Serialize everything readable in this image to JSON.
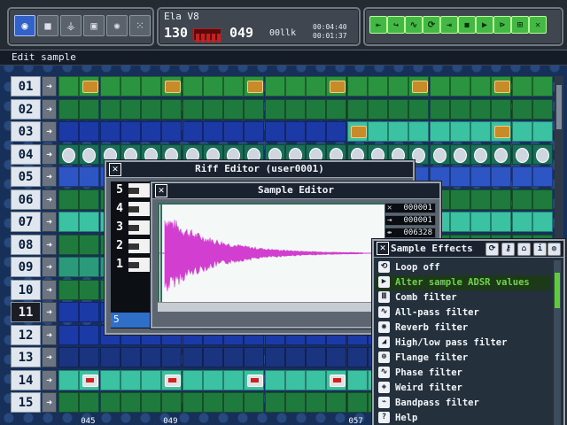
{
  "toolbar": {
    "tool_icons": [
      "mode-icon",
      "pattern-icon",
      "plug-icon",
      "save-icon",
      "spiral-icon",
      "grid-icon"
    ]
  },
  "song": {
    "name": "Ela V8",
    "bpm": "130",
    "position": "049",
    "pattern_label": "00llk",
    "time_current": "00:04:40",
    "time_total": "00:01:37"
  },
  "transport": {
    "buttons": [
      "rewind",
      "prev",
      "loop",
      "loop-alt",
      "forward",
      "record",
      "play",
      "cue",
      "next",
      "stop",
      "wave"
    ]
  },
  "edit_label": "Edit sample",
  "tracks": [
    "01",
    "02",
    "03",
    "04",
    "05",
    "06",
    "07",
    "08",
    "09",
    "10",
    "11",
    "12",
    "13",
    "14",
    "15"
  ],
  "column_numbers": [
    "045",
    "049",
    "057"
  ],
  "riff_editor": {
    "title": "Riff Editor (user0001)",
    "pattern_rows": [
      "5",
      "4",
      "3",
      "2",
      "1"
    ],
    "current_pattern": "5"
  },
  "sample_editor": {
    "title": "Sample Editor",
    "start": "000001",
    "end": "000001",
    "length": "006328"
  },
  "sample_effects": {
    "title": "Sample Effects",
    "items": [
      {
        "label": "Loop off",
        "icon": "loop-icon"
      },
      {
        "label": "Alter sample ADSR values",
        "icon": "adsr-icon",
        "selected": true
      },
      {
        "label": "Comb filter",
        "icon": "comb-icon"
      },
      {
        "label": "All-pass filter",
        "icon": "allpass-icon"
      },
      {
        "label": "Reverb filter",
        "icon": "reverb-icon"
      },
      {
        "label": "High/low pass filter",
        "icon": "highlow-icon"
      },
      {
        "label": "Flange filter",
        "icon": "flange-icon"
      },
      {
        "label": "Phase filter",
        "icon": "phase-icon"
      },
      {
        "label": "Weird filter",
        "icon": "weird-icon"
      },
      {
        "label": "Bandpass filter",
        "icon": "bandpass-icon"
      },
      {
        "label": "Help",
        "icon": "help-icon"
      }
    ]
  },
  "colors": {
    "accent_green": "#44b844",
    "selected_text": "#6fd24c",
    "waveform": "#d23fd0"
  }
}
